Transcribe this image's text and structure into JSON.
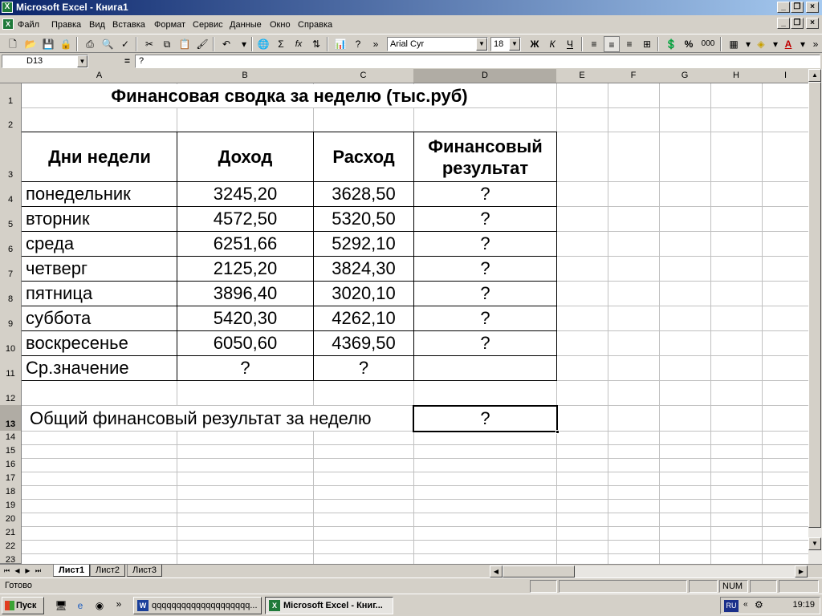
{
  "window": {
    "title": "Microsoft Excel - Книга1"
  },
  "menu": [
    "Файл",
    "Правка",
    "Вид",
    "Вставка",
    "Формат",
    "Сервис",
    "Данные",
    "Окно",
    "Справка"
  ],
  "toolbar": {
    "font_name": "Arial Cyr",
    "font_size": "18",
    "bold": "Ж",
    "italic": "К",
    "underline": "Ч",
    "percent": "%",
    "thousands": "000",
    "sum": "Σ",
    "fx": "fx"
  },
  "formula_bar": {
    "name_box": "D13",
    "equals": "=",
    "value": "?"
  },
  "columns": [
    "A",
    "B",
    "C",
    "D",
    "E",
    "F",
    "G",
    "H",
    "I"
  ],
  "rows": [
    "1",
    "2",
    "3",
    "4",
    "5",
    "6",
    "7",
    "8",
    "9",
    "10",
    "11",
    "12",
    "13",
    "14",
    "15",
    "16",
    "17",
    "18",
    "19",
    "20",
    "21",
    "22",
    "23"
  ],
  "sheet": {
    "title": "Финансовая сводка за неделю (тыс.руб)",
    "headers": {
      "day": "Дни недели",
      "income": "Доход",
      "expense": "Расход",
      "result_line1": "Финансовый",
      "result_line2": "результат"
    },
    "days": [
      {
        "day": "понедельник",
        "income": "3245,20",
        "expense": "3628,50",
        "result": "?"
      },
      {
        "day": "вторник",
        "income": "4572,50",
        "expense": "5320,50",
        "result": "?"
      },
      {
        "day": "среда",
        "income": "6251,66",
        "expense": "5292,10",
        "result": "?"
      },
      {
        "day": "четверг",
        "income": "2125,20",
        "expense": "3824,30",
        "result": "?"
      },
      {
        "day": "пятница",
        "income": "3896,40",
        "expense": "3020,10",
        "result": "?"
      },
      {
        "day": "суббота",
        "income": "5420,30",
        "expense": "4262,10",
        "result": "?"
      },
      {
        "day": "воскресенье",
        "income": "6050,60",
        "expense": "4369,50",
        "result": "?"
      }
    ],
    "average": {
      "label": "Ср.значение",
      "income": "?",
      "expense": "?"
    },
    "total": {
      "label": "Общий финансовый результат за неделю",
      "value": "?"
    }
  },
  "sheet_tabs": [
    "Лист1",
    "Лист2",
    "Лист3"
  ],
  "status": {
    "text": "Готово",
    "num": "NUM"
  },
  "taskbar": {
    "start": "Пуск",
    "tasks": [
      "qqqqqqqqqqqqqqqqqqqq...",
      "Microsoft Excel - Книг..."
    ],
    "lang": "RU",
    "clock": "19:19"
  }
}
